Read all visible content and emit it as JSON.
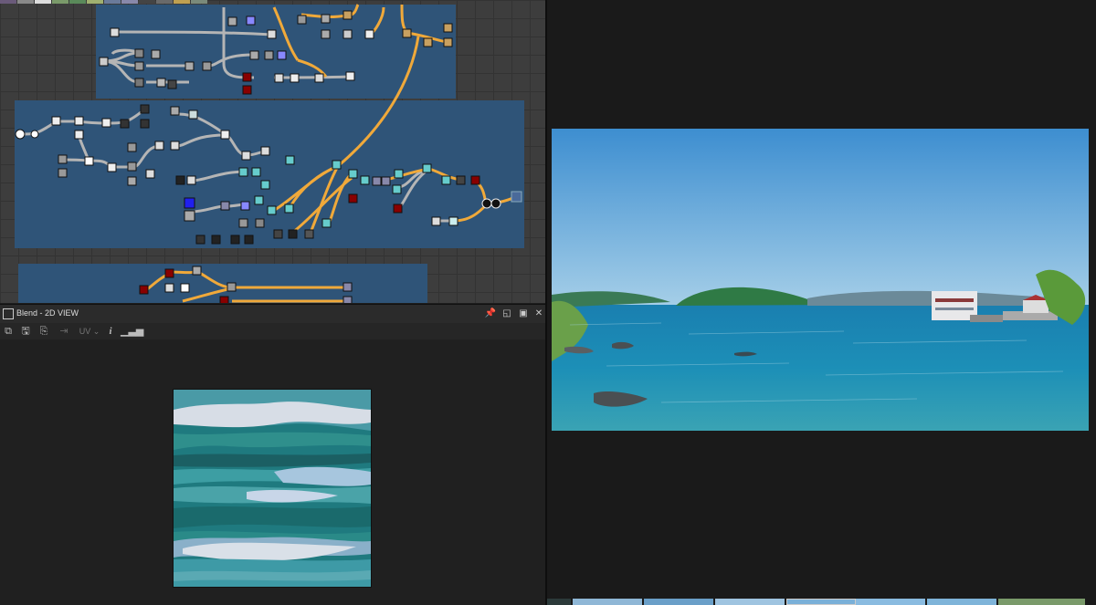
{
  "graph": {
    "name": "node-graph-editor"
  },
  "panel": {
    "title": "Blend - 2D VIEW",
    "header_buttons": [
      "pin-icon",
      "float-icon",
      "maximize-icon",
      "close-icon"
    ],
    "toolbar": {
      "uv_label": "UV",
      "info_label": "i",
      "icons": [
        "copy-icon",
        "save-icon",
        "duplicate-icon",
        "export-icon",
        "uv-dropdown",
        "info-icon",
        "histogram-icon"
      ]
    }
  },
  "viewer": {
    "name": "reference-image-viewer"
  },
  "colors": {
    "frame_blue": "#2f5478",
    "wire_orange": "#f0a93a",
    "wire_gray": "#b5b5b5",
    "panel_bg": "#202020"
  }
}
